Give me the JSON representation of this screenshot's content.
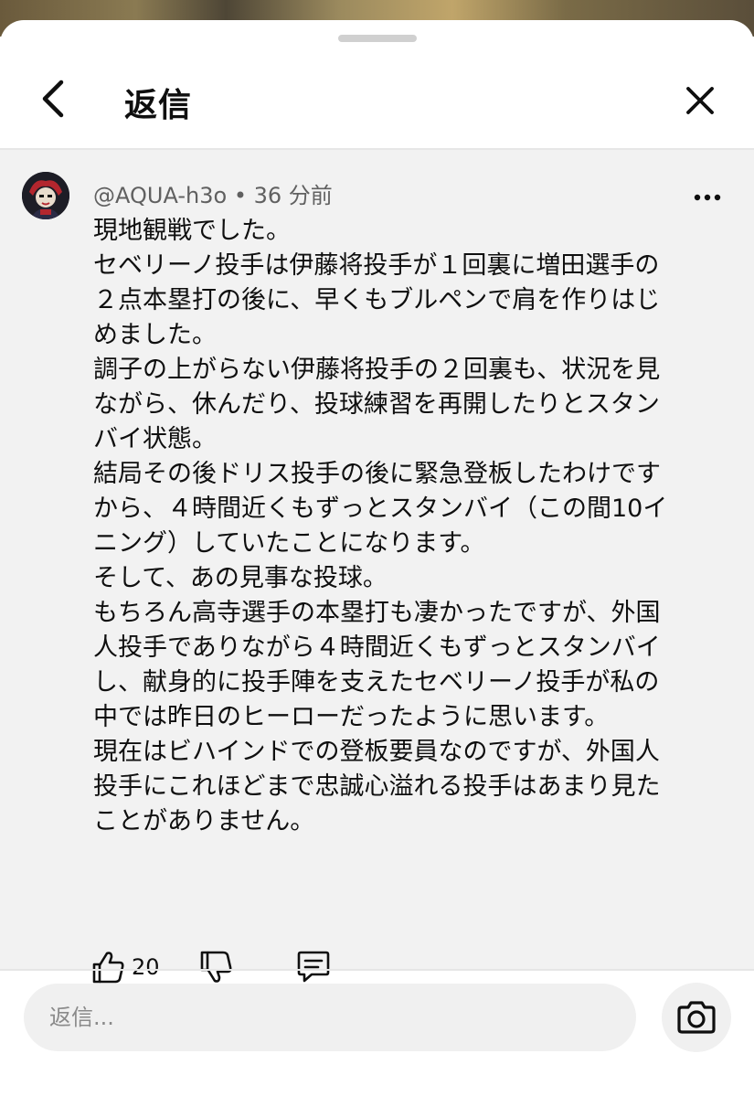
{
  "header": {
    "title": "返信"
  },
  "comment": {
    "author": "@AQUA-h3o",
    "separator": "•",
    "time": "36 分前",
    "lines": [
      "現地観戦でした。",
      "セベリーノ投手は伊藤将投手が１回裏に増田選手の",
      "２点本塁打の後に、早くもブルペンで肩を作りはじ",
      "めました。",
      "調子の上がらない伊藤将投手の２回裏も、状況を見",
      "ながら、休んだり、投球練習を再開したりとスタン",
      "バイ状態。",
      "結局その後ドリス投手の後に緊急登板したわけです",
      "から、４時間近くもずっとスタンバイ（この間10イ",
      "ニング）していたことになります。",
      "そして、あの見事な投球。",
      "もちろん高寺選手の本塁打も凄かったですが、外国",
      "人投手でありながら４時間近くもずっとスタンバイ",
      "し、献身的に投手陣を支えたセベリーノ投手が私の",
      "中では昨日のヒーローだったように思います。",
      "現在はビハインドでの登板要員なのですが、外国人",
      "投手にこれほどまで忠誠心溢れる投手はあまり見た",
      "ことがありません。"
    ],
    "like_count": "20"
  },
  "reply_box": {
    "placeholder": "返信..."
  },
  "icons": {
    "back": "chevron-left-icon",
    "close": "close-icon",
    "more": "more-vert-icon",
    "like": "thumbs-up-icon",
    "dislike": "thumbs-down-icon",
    "reply": "comment-icon",
    "camera": "camera-icon"
  }
}
